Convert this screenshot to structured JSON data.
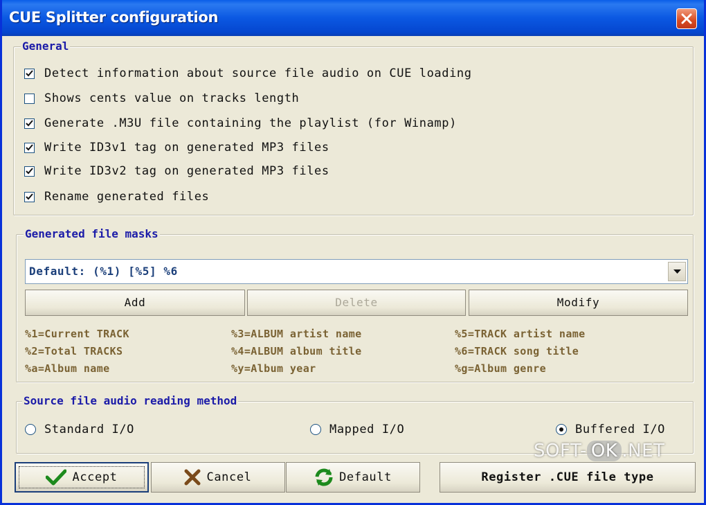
{
  "window": {
    "title": "CUE Splitter configuration"
  },
  "general": {
    "legend": "General",
    "options": [
      {
        "label": "Detect information about source file audio on CUE loading",
        "checked": true
      },
      {
        "label": "Shows cents value on tracks length",
        "checked": false
      },
      {
        "label": "Generate .M3U file containing the playlist (for Winamp)",
        "checked": true
      },
      {
        "label": "Write ID3v1 tag on generated MP3 files",
        "checked": true
      },
      {
        "label": "Write ID3v2 tag on generated MP3 files",
        "checked": true
      },
      {
        "label": "Rename generated files",
        "checked": true
      }
    ]
  },
  "masks": {
    "legend": "Generated file masks",
    "selected": "Default: (%1) [%5] %6",
    "add_label": "Add",
    "delete_label": "Delete",
    "modify_label": "Modify",
    "hints": [
      "%1=Current TRACK",
      "%3=ALBUM artist name",
      "%5=TRACK artist name",
      "%2=Total TRACKS",
      "%4=ALBUM album title",
      "%6=TRACK song title",
      "%a=Album name",
      "%y=Album year",
      "%g=Album genre"
    ]
  },
  "reading": {
    "legend": "Source file audio reading method",
    "options": [
      {
        "label": "Standard I/O",
        "selected": false
      },
      {
        "label": "Mapped I/O",
        "selected": false
      },
      {
        "label": "Buffered I/O",
        "selected": true
      }
    ]
  },
  "footer": {
    "accept_label": "Accept",
    "cancel_label": "Cancel",
    "default_label": "Default",
    "register_label": "Register .CUE file type"
  },
  "watermark": {
    "left": "SOFT-",
    "ok": "OK",
    "right": ".NET"
  },
  "colors": {
    "title_bar": "#0b58e2",
    "legend": "#1b1ba8",
    "hint": "#7a6233",
    "background": "#ece9d8"
  }
}
